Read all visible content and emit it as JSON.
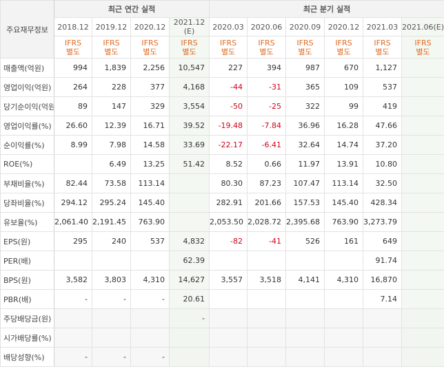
{
  "header": {
    "label": "주요재무정보",
    "annual_title": "최근 연간 실적",
    "quarter_title": "최근 분기 실적"
  },
  "annual_periods": [
    "2018.12",
    "2019.12",
    "2020.12",
    "2021.12"
  ],
  "annual_estimate_mark": "(E)",
  "quarter_periods": [
    "2020.03",
    "2020.06",
    "2020.09",
    "2020.12",
    "2021.03",
    "2021.06(E)"
  ],
  "ifrs": {
    "line1": "IFRS",
    "line2": "별도"
  },
  "rows": [
    {
      "label": "매출액(억원)",
      "annual": [
        "994",
        "1,839",
        "2,256",
        "10,547"
      ],
      "quarter": [
        "227",
        "394",
        "987",
        "670",
        "1,127",
        ""
      ]
    },
    {
      "label": "영업이익(억원)",
      "annual": [
        "264",
        "228",
        "377",
        "4,168"
      ],
      "quarter": [
        "-44",
        "-31",
        "365",
        "109",
        "537",
        ""
      ]
    },
    {
      "label": "당기순이익(억원)",
      "annual": [
        "89",
        "147",
        "329",
        "3,554"
      ],
      "quarter": [
        "-50",
        "-25",
        "322",
        "99",
        "419",
        ""
      ]
    },
    {
      "label": "영업이익률(%)",
      "annual": [
        "26.60",
        "12.39",
        "16.71",
        "39.52"
      ],
      "quarter": [
        "-19.48",
        "-7.84",
        "36.96",
        "16.28",
        "47.66",
        ""
      ]
    },
    {
      "label": "순이익률(%)",
      "annual": [
        "8.99",
        "7.98",
        "14.58",
        "33.69"
      ],
      "quarter": [
        "-22.17",
        "-6.41",
        "32.64",
        "14.74",
        "37.20",
        ""
      ]
    },
    {
      "label": "ROE(%)",
      "annual": [
        "",
        "6.49",
        "13.25",
        "51.42"
      ],
      "quarter": [
        "8.52",
        "0.66",
        "11.97",
        "13.91",
        "10.80",
        ""
      ]
    },
    {
      "label": "부채비율(%)",
      "annual": [
        "82.44",
        "73.58",
        "113.14",
        ""
      ],
      "quarter": [
        "80.30",
        "87.23",
        "107.47",
        "113.14",
        "32.50",
        ""
      ]
    },
    {
      "label": "당좌비율(%)",
      "annual": [
        "294.12",
        "295.24",
        "145.40",
        ""
      ],
      "quarter": [
        "282.91",
        "201.66",
        "157.53",
        "145.40",
        "428.34",
        ""
      ]
    },
    {
      "label": "유보율(%)",
      "annual": [
        "2,061.40",
        "2,191.45",
        "763.90",
        ""
      ],
      "quarter": [
        "2,053.50",
        "2,028.72",
        "2,395.68",
        "763.90",
        "3,273.79",
        ""
      ]
    },
    {
      "label": "EPS(원)",
      "annual": [
        "295",
        "240",
        "537",
        "4,832"
      ],
      "quarter": [
        "-82",
        "-41",
        "526",
        "161",
        "649",
        ""
      ]
    },
    {
      "label": "PER(배)",
      "annual": [
        "",
        "",
        "",
        "62.39"
      ],
      "quarter": [
        "",
        "",
        "",
        "",
        "91.74",
        ""
      ]
    },
    {
      "label": "BPS(원)",
      "annual": [
        "3,582",
        "3,803",
        "4,310",
        "14,627"
      ],
      "quarter": [
        "3,557",
        "3,518",
        "4,141",
        "4,310",
        "16,870",
        ""
      ]
    },
    {
      "label": "PBR(배)",
      "annual": [
        "-",
        "-",
        "-",
        "20.61"
      ],
      "quarter": [
        "",
        "",
        "",
        "",
        "7.14",
        ""
      ]
    },
    {
      "label": "주당배당금(원)",
      "annual": [
        "",
        "",
        "",
        "-"
      ],
      "quarter": [
        "",
        "",
        "",
        "",
        "",
        ""
      ]
    },
    {
      "label": "시가배당률(%)",
      "annual": [
        "",
        "",
        "",
        ""
      ],
      "quarter": [
        "",
        "",
        "",
        "",
        "",
        ""
      ]
    },
    {
      "label": "배당성향(%)",
      "annual": [
        "-",
        "-",
        "-",
        ""
      ],
      "quarter": [
        "",
        "",
        "",
        "",
        "",
        ""
      ]
    }
  ],
  "colors": {
    "negative": "#d0021b",
    "ifrs": "#e06a21",
    "estimate_bg": "#f4f8f2"
  }
}
